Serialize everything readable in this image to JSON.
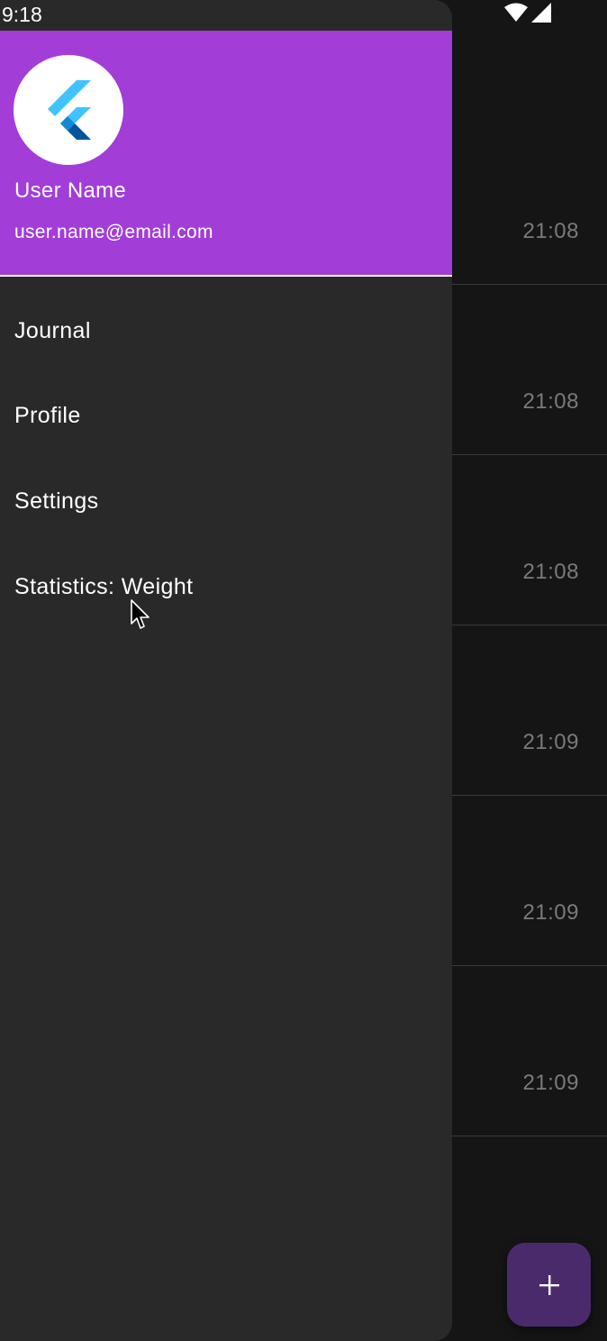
{
  "status_bar": {
    "time": "9:18",
    "icons": [
      "wifi-icon",
      "cell-signal-icon"
    ]
  },
  "drawer": {
    "header": {
      "avatar_icon": "flutter-logo-icon",
      "user_name": "User Name",
      "user_email": "user.name@email.com",
      "accent_color": "#a23dd8"
    },
    "menu_items": [
      {
        "label": "Journal"
      },
      {
        "label": "Profile"
      },
      {
        "label": "Settings"
      },
      {
        "label": "Statistics: Weight"
      }
    ]
  },
  "background_list": {
    "rows": [
      {
        "time": "21:08"
      },
      {
        "time": "21:08"
      },
      {
        "time": "21:08"
      },
      {
        "time": "21:09"
      },
      {
        "time": "21:09"
      },
      {
        "time": "21:09"
      }
    ]
  },
  "fab": {
    "icon": "plus-icon",
    "color": "#4b2a6b"
  }
}
